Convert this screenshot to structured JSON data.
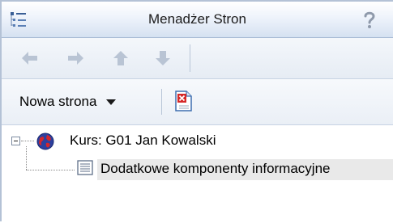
{
  "window": {
    "title": "Menadżer Stron",
    "icons": {
      "title": "page-tree-icon",
      "help": "help-icon"
    }
  },
  "nav_toolbar": {
    "buttons": [
      {
        "name": "back",
        "icon": "arrow-left-icon",
        "enabled": false
      },
      {
        "name": "forward",
        "icon": "arrow-right-icon",
        "enabled": false
      },
      {
        "name": "up",
        "icon": "arrow-up-icon",
        "enabled": false
      },
      {
        "name": "down",
        "icon": "arrow-down-icon",
        "enabled": false
      }
    ]
  },
  "page_toolbar": {
    "new_page_label": "Nowa strona",
    "delete_page_icon": "delete-page-icon"
  },
  "tree": {
    "root": {
      "label": "Kurs: G01 Jan Kowalski",
      "icon": "course-globe-icon",
      "expanded": true,
      "children": [
        {
          "label": "Dodatkowe komponenty informacyjne",
          "icon": "document-icon",
          "selected": true
        }
      ]
    }
  },
  "colors": {
    "title_gradient_end": "#d5e1f1",
    "selected_row": "#e9e9e9",
    "disabled_arrow": "#b9c4d4"
  }
}
